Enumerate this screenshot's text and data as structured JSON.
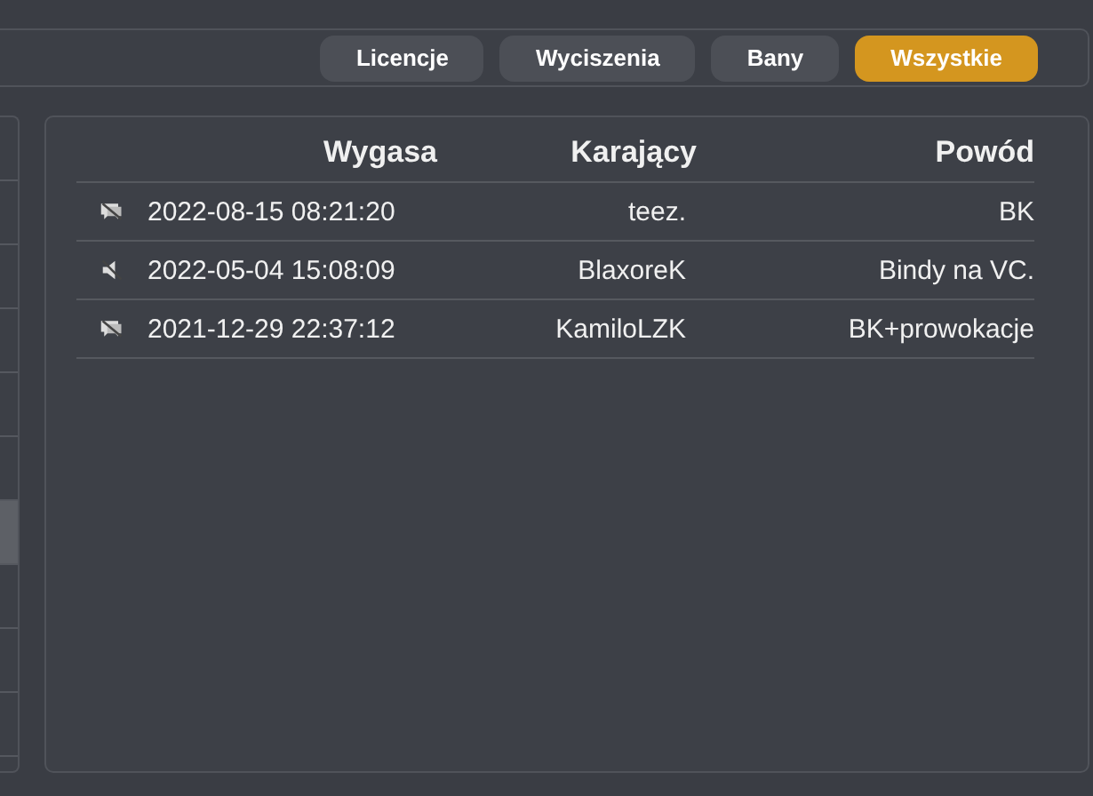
{
  "filters": [
    {
      "label": "Licencje",
      "selected": false
    },
    {
      "label": "Wyciszenia",
      "selected": false
    },
    {
      "label": "Bany",
      "selected": false
    },
    {
      "label": "Wszystkie",
      "selected": true
    }
  ],
  "side_list": {
    "items": [
      {
        "selected": false
      },
      {
        "selected": false
      },
      {
        "selected": false
      },
      {
        "selected": false
      },
      {
        "selected": false
      },
      {
        "selected": false
      },
      {
        "selected": true
      },
      {
        "selected": false
      },
      {
        "selected": false
      },
      {
        "selected": false
      }
    ]
  },
  "table": {
    "columns": [
      "Wygasa",
      "Karający",
      "Powód"
    ],
    "rows": [
      {
        "kind": "chat",
        "expires": "2022-08-15 08:21:20",
        "by": "teez.",
        "reason": "BK"
      },
      {
        "kind": "mute",
        "expires": "2022-05-04 15:08:09",
        "by": "BlaxoreK",
        "reason": "Bindy na VC."
      },
      {
        "kind": "chat",
        "expires": "2021-12-29 22:37:12",
        "by": "KamiloLZK",
        "reason": "BK+prowokacje"
      }
    ]
  }
}
